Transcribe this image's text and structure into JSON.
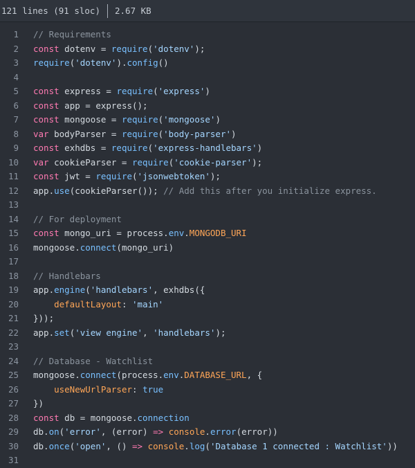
{
  "header": {
    "lines_info": "121 lines (91 sloc)",
    "file_size": "2.67 KB"
  },
  "colors": {
    "background": "#2b2f36",
    "line_number": "#8c95a1",
    "comment": "#8b949e",
    "keyword": "#ff7ab2",
    "string": "#a5d6ff",
    "function": "#79c0ff",
    "property": "#ffa657"
  },
  "lines": [
    {
      "n": "1",
      "tokens": [
        {
          "t": "comment",
          "v": "// Requirements"
        }
      ]
    },
    {
      "n": "2",
      "tokens": [
        {
          "t": "keyword",
          "v": "const"
        },
        {
          "t": "plain",
          "v": " dotenv = "
        },
        {
          "t": "func",
          "v": "require"
        },
        {
          "t": "plain",
          "v": "("
        },
        {
          "t": "string",
          "v": "'dotenv'"
        },
        {
          "t": "plain",
          "v": ");"
        }
      ]
    },
    {
      "n": "3",
      "tokens": [
        {
          "t": "func",
          "v": "require"
        },
        {
          "t": "plain",
          "v": "("
        },
        {
          "t": "string",
          "v": "'dotenv'"
        },
        {
          "t": "plain",
          "v": ")."
        },
        {
          "t": "func",
          "v": "config"
        },
        {
          "t": "plain",
          "v": "()"
        }
      ]
    },
    {
      "n": "4",
      "tokens": []
    },
    {
      "n": "5",
      "tokens": [
        {
          "t": "keyword",
          "v": "const"
        },
        {
          "t": "plain",
          "v": " express = "
        },
        {
          "t": "func",
          "v": "require"
        },
        {
          "t": "plain",
          "v": "("
        },
        {
          "t": "string",
          "v": "'express'"
        },
        {
          "t": "plain",
          "v": ")"
        }
      ]
    },
    {
      "n": "6",
      "tokens": [
        {
          "t": "keyword",
          "v": "const"
        },
        {
          "t": "plain",
          "v": " app = express();"
        }
      ]
    },
    {
      "n": "7",
      "tokens": [
        {
          "t": "keyword",
          "v": "const"
        },
        {
          "t": "plain",
          "v": " mongoose = "
        },
        {
          "t": "func",
          "v": "require"
        },
        {
          "t": "plain",
          "v": "("
        },
        {
          "t": "string",
          "v": "'mongoose'"
        },
        {
          "t": "plain",
          "v": ")"
        }
      ]
    },
    {
      "n": "8",
      "tokens": [
        {
          "t": "keyword",
          "v": "var"
        },
        {
          "t": "plain",
          "v": " bodyParser = "
        },
        {
          "t": "func",
          "v": "require"
        },
        {
          "t": "plain",
          "v": "("
        },
        {
          "t": "string",
          "v": "'body-parser'"
        },
        {
          "t": "plain",
          "v": ")"
        }
      ]
    },
    {
      "n": "9",
      "tokens": [
        {
          "t": "keyword",
          "v": "const"
        },
        {
          "t": "plain",
          "v": " exhdbs = "
        },
        {
          "t": "func",
          "v": "require"
        },
        {
          "t": "plain",
          "v": "("
        },
        {
          "t": "string",
          "v": "'express-handlebars'"
        },
        {
          "t": "plain",
          "v": ")"
        }
      ]
    },
    {
      "n": "10",
      "tokens": [
        {
          "t": "keyword",
          "v": "var"
        },
        {
          "t": "plain",
          "v": " cookieParser = "
        },
        {
          "t": "func",
          "v": "require"
        },
        {
          "t": "plain",
          "v": "("
        },
        {
          "t": "string",
          "v": "'cookie-parser'"
        },
        {
          "t": "plain",
          "v": ");"
        }
      ]
    },
    {
      "n": "11",
      "tokens": [
        {
          "t": "keyword",
          "v": "const"
        },
        {
          "t": "plain",
          "v": " jwt = "
        },
        {
          "t": "func",
          "v": "require"
        },
        {
          "t": "plain",
          "v": "("
        },
        {
          "t": "string",
          "v": "'jsonwebtoken'"
        },
        {
          "t": "plain",
          "v": ");"
        }
      ]
    },
    {
      "n": "12",
      "tokens": [
        {
          "t": "plain",
          "v": "app."
        },
        {
          "t": "func",
          "v": "use"
        },
        {
          "t": "plain",
          "v": "(cookieParser()); "
        },
        {
          "t": "comment",
          "v": "// Add this after you initialize express."
        }
      ]
    },
    {
      "n": "13",
      "tokens": []
    },
    {
      "n": "14",
      "tokens": [
        {
          "t": "comment",
          "v": "// For deployment"
        }
      ]
    },
    {
      "n": "15",
      "tokens": [
        {
          "t": "keyword",
          "v": "const"
        },
        {
          "t": "plain",
          "v": " mongo_uri = process."
        },
        {
          "t": "func",
          "v": "env"
        },
        {
          "t": "plain",
          "v": "."
        },
        {
          "t": "property",
          "v": "MONGODB_URI"
        }
      ]
    },
    {
      "n": "16",
      "tokens": [
        {
          "t": "plain",
          "v": "mongoose."
        },
        {
          "t": "func",
          "v": "connect"
        },
        {
          "t": "plain",
          "v": "(mongo_uri)"
        }
      ]
    },
    {
      "n": "17",
      "tokens": []
    },
    {
      "n": "18",
      "tokens": [
        {
          "t": "comment",
          "v": "// Handlebars"
        }
      ]
    },
    {
      "n": "19",
      "tokens": [
        {
          "t": "plain",
          "v": "app."
        },
        {
          "t": "func",
          "v": "engine"
        },
        {
          "t": "plain",
          "v": "("
        },
        {
          "t": "string",
          "v": "'handlebars'"
        },
        {
          "t": "plain",
          "v": ", exhdbs({"
        }
      ]
    },
    {
      "n": "20",
      "tokens": [
        {
          "t": "plain",
          "v": "    "
        },
        {
          "t": "property",
          "v": "defaultLayout"
        },
        {
          "t": "plain",
          "v": ": "
        },
        {
          "t": "string",
          "v": "'main'"
        }
      ]
    },
    {
      "n": "21",
      "tokens": [
        {
          "t": "plain",
          "v": "}));"
        }
      ]
    },
    {
      "n": "22",
      "tokens": [
        {
          "t": "plain",
          "v": "app."
        },
        {
          "t": "func",
          "v": "set"
        },
        {
          "t": "plain",
          "v": "("
        },
        {
          "t": "string",
          "v": "'view engine'"
        },
        {
          "t": "plain",
          "v": ", "
        },
        {
          "t": "string",
          "v": "'handlebars'"
        },
        {
          "t": "plain",
          "v": ");"
        }
      ]
    },
    {
      "n": "23",
      "tokens": []
    },
    {
      "n": "24",
      "tokens": [
        {
          "t": "comment",
          "v": "// Database - Watchlist"
        }
      ]
    },
    {
      "n": "25",
      "tokens": [
        {
          "t": "plain",
          "v": "mongoose."
        },
        {
          "t": "func",
          "v": "connect"
        },
        {
          "t": "plain",
          "v": "(process."
        },
        {
          "t": "func",
          "v": "env"
        },
        {
          "t": "plain",
          "v": "."
        },
        {
          "t": "property",
          "v": "DATABASE_URL"
        },
        {
          "t": "plain",
          "v": ", {"
        }
      ]
    },
    {
      "n": "26",
      "tokens": [
        {
          "t": "plain",
          "v": "    "
        },
        {
          "t": "property",
          "v": "useNewUrlParser"
        },
        {
          "t": "plain",
          "v": ": "
        },
        {
          "t": "func",
          "v": "true"
        }
      ]
    },
    {
      "n": "27",
      "tokens": [
        {
          "t": "plain",
          "v": "})"
        }
      ]
    },
    {
      "n": "28",
      "tokens": [
        {
          "t": "keyword",
          "v": "const"
        },
        {
          "t": "plain",
          "v": " db = mongoose."
        },
        {
          "t": "func",
          "v": "connection"
        }
      ]
    },
    {
      "n": "29",
      "tokens": [
        {
          "t": "plain",
          "v": "db."
        },
        {
          "t": "func",
          "v": "on"
        },
        {
          "t": "plain",
          "v": "("
        },
        {
          "t": "string",
          "v": "'error'"
        },
        {
          "t": "plain",
          "v": ", (error) "
        },
        {
          "t": "keyword",
          "v": "=>"
        },
        {
          "t": "plain",
          "v": " "
        },
        {
          "t": "property",
          "v": "console"
        },
        {
          "t": "plain",
          "v": "."
        },
        {
          "t": "func",
          "v": "error"
        },
        {
          "t": "plain",
          "v": "(error))"
        }
      ]
    },
    {
      "n": "30",
      "tokens": [
        {
          "t": "plain",
          "v": "db."
        },
        {
          "t": "func",
          "v": "once"
        },
        {
          "t": "plain",
          "v": "("
        },
        {
          "t": "string",
          "v": "'open'"
        },
        {
          "t": "plain",
          "v": ", () "
        },
        {
          "t": "keyword",
          "v": "=>"
        },
        {
          "t": "plain",
          "v": " "
        },
        {
          "t": "property",
          "v": "console"
        },
        {
          "t": "plain",
          "v": "."
        },
        {
          "t": "func",
          "v": "log"
        },
        {
          "t": "plain",
          "v": "("
        },
        {
          "t": "string",
          "v": "'Database 1 connected : Watchlist'"
        },
        {
          "t": "plain",
          "v": "))"
        }
      ]
    },
    {
      "n": "31",
      "tokens": []
    }
  ]
}
